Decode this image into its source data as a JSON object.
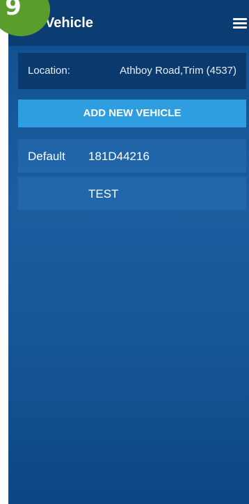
{
  "step": {
    "number": "9"
  },
  "appbar": {
    "title": "Vehicle",
    "menu_icon": "hamburger-menu-icon"
  },
  "location": {
    "label": "Location:",
    "value": "Athboy Road,Trim (4537)"
  },
  "actions": {
    "add_vehicle_label": "ADD NEW VEHICLE"
  },
  "vehicles": [
    {
      "default_label": "Default",
      "registration": "181D44216"
    },
    {
      "default_label": "",
      "registration": "TEST"
    }
  ],
  "colors": {
    "appbar": "#0b3d72",
    "background": "#1b5fa0",
    "button": "#2e9ee0",
    "badge": "#5a9d2c"
  }
}
